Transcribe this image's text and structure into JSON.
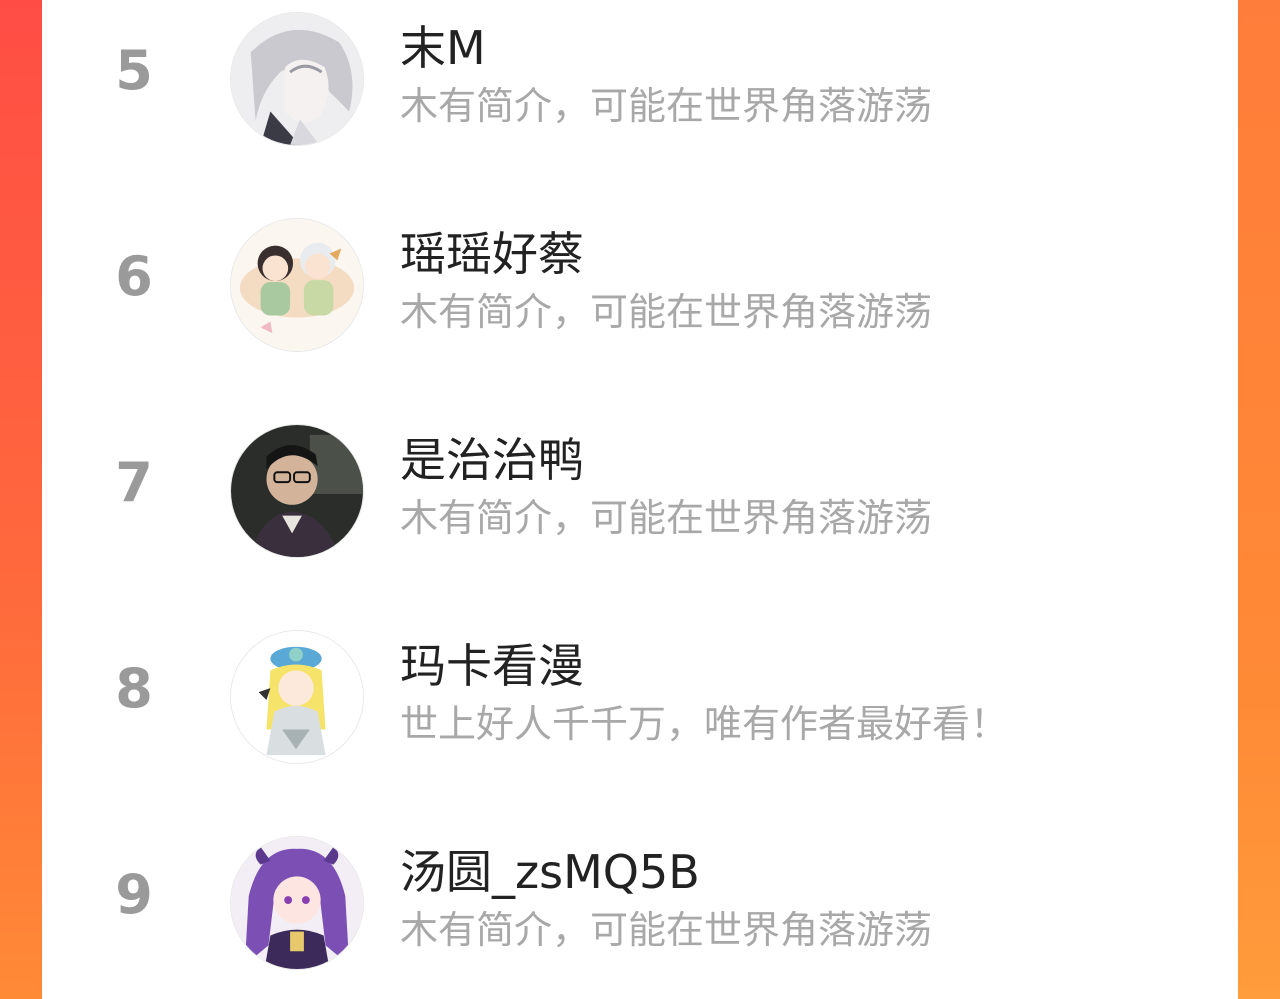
{
  "ranking": {
    "rows": [
      {
        "rank": "5",
        "name": "末M",
        "bio": "木有简介，可能在世界角落游荡",
        "avatar_icon": "avatar-anime-silver-hair-icon"
      },
      {
        "rank": "6",
        "name": "瑶瑶好蔡",
        "bio": "木有简介，可能在世界角落游荡",
        "avatar_icon": "avatar-chibi-duo-icon"
      },
      {
        "rank": "7",
        "name": "是治治鸭",
        "bio": "木有简介，可能在世界角落游荡",
        "avatar_icon": "avatar-photo-glasses-icon"
      },
      {
        "rank": "8",
        "name": "玛卡看漫",
        "bio": "世上好人千千万，唯有作者最好看！",
        "avatar_icon": "avatar-chibi-blonde-icon"
      },
      {
        "rank": "9",
        "name": "汤圆_zsMQ5B",
        "bio": "木有简介，可能在世界角落游荡",
        "avatar_icon": "avatar-anime-purple-hair-icon"
      }
    ]
  },
  "colors": {
    "frame_left": "#ff4d45",
    "frame_right": "#ff8a36",
    "rank_text": "#9a9a9a",
    "name_text": "#222222",
    "bio_text": "#a8a8a8"
  }
}
